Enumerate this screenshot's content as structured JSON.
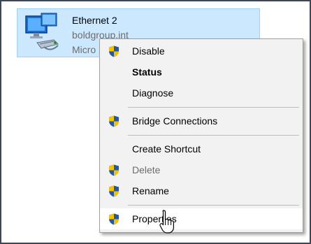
{
  "adapter": {
    "name": "Ethernet 2",
    "network": "boldgroup.int",
    "device": "Micro"
  },
  "menu": {
    "disable": "Disable",
    "status": "Status",
    "diagnose": "Diagnose",
    "bridge": "Bridge Connections",
    "shortcut": "Create Shortcut",
    "delete": "Delete",
    "rename": "Rename",
    "properties": "Properties"
  },
  "colors": {
    "selection_bg": "#cce8ff",
    "menu_bg": "#f2f2f2",
    "hover_bg": "#ffffff",
    "disabled_text": "#6d6d6d",
    "shield_blue": "#2457a6",
    "shield_yellow": "#f2c300"
  },
  "icons": {
    "adapter": "network-adapter-icon",
    "uac": "uac-shield-icon",
    "pointer": "mouse-pointer-icon"
  },
  "state": {
    "hovered_item": "Properties"
  }
}
